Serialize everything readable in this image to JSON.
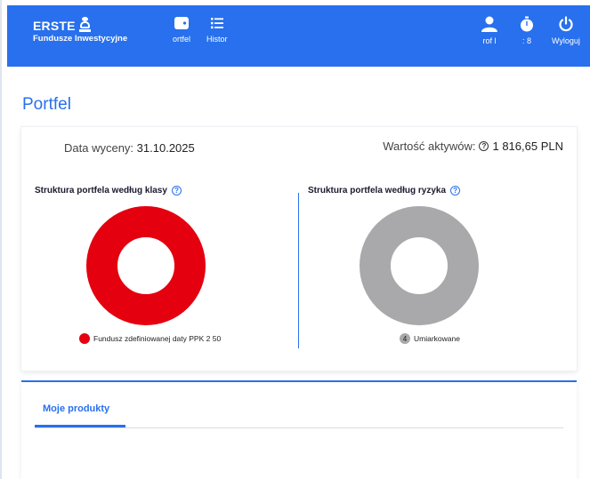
{
  "header": {
    "brand_name": "ERSTE",
    "brand_sub": "Fundusze Inwestycyjne",
    "nav": [
      {
        "label": "ortfel",
        "icon": "wallet-icon"
      },
      {
        "label": "Histor",
        "icon": "list-icon"
      }
    ],
    "user": {
      "label": "rof l",
      "icon": "user-icon"
    },
    "timer": {
      "label": ": 8",
      "icon": "timer-icon"
    },
    "logout": {
      "label": "Wyloguj",
      "icon": "power-icon"
    }
  },
  "page": {
    "title": "Portfel"
  },
  "summary": {
    "date_label": "Data wyceny:",
    "date_value": "31.10.2025",
    "assets_label": "Wartość aktywów:",
    "assets_value": "1 816,65 PLN"
  },
  "class_section": {
    "title": "Struktura portfela według klasy",
    "legend": "Fundusz zdefiniowanej daty PPK 2 50",
    "color": "#e4000f"
  },
  "risk_section": {
    "title": "Struktura portfela według ryzyka",
    "legend_number": "4",
    "legend": "Umiarkowane",
    "color": "#a9a8aa"
  },
  "products": {
    "tab_label": "Moje produkty"
  },
  "colors": {
    "accent": "#2870ed",
    "class_donut": "#e4000f",
    "risk_donut": "#a9a8aa"
  }
}
